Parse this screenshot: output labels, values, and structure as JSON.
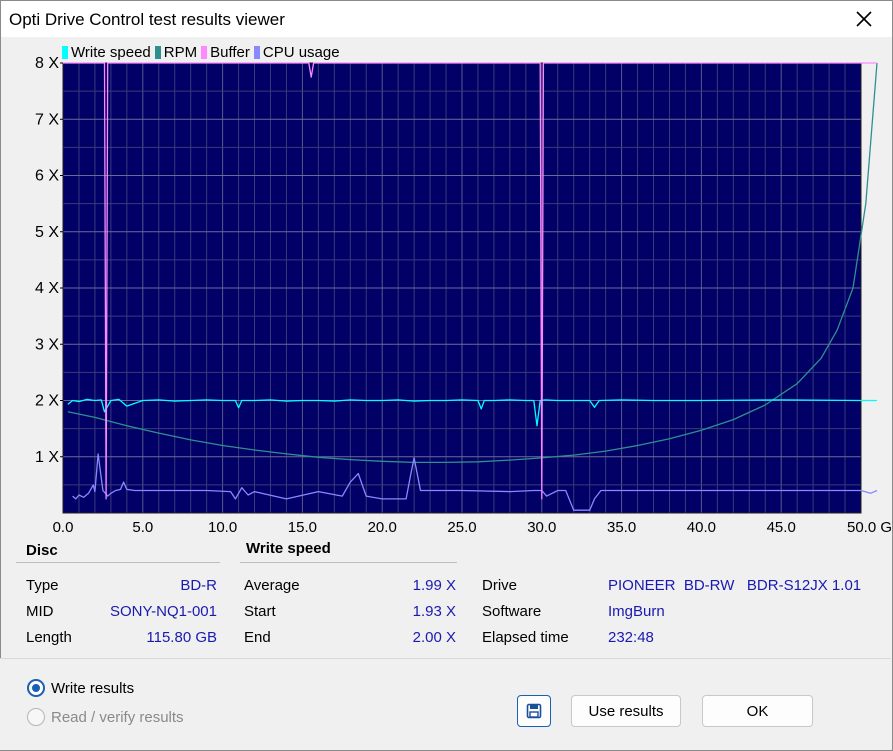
{
  "window": {
    "title": "Opti Drive Control test results viewer"
  },
  "legend": [
    {
      "label": "Write speed",
      "color": "#00ffff"
    },
    {
      "label": "RPM",
      "color": "#2f8f8f"
    },
    {
      "label": "Buffer",
      "color": "#ff88ff"
    },
    {
      "label": "CPU usage",
      "color": "#8888ff"
    }
  ],
  "chart_data": {
    "type": "line",
    "xlabel": "",
    "ylabel": "",
    "xlim": [
      0,
      50
    ],
    "ylim": [
      0,
      8
    ],
    "x_ticks": [
      "0.0",
      "5.0",
      "10.0",
      "15.0",
      "20.0",
      "25.0",
      "30.0",
      "35.0",
      "40.0",
      "45.0",
      "50.0 GB"
    ],
    "y_ticks": [
      "1 X",
      "2 X",
      "3 X",
      "4 X",
      "5 X",
      "6 X",
      "7 X",
      "8 X"
    ],
    "grid": true,
    "legend_position": "top-left",
    "series": [
      {
        "name": "Write speed",
        "color": "#00ffff",
        "x": [
          0.3,
          0.6,
          1.0,
          1.5,
          2.0,
          2.4,
          2.6,
          3.0,
          3.5,
          4.0,
          5.0,
          6.0,
          7.0,
          8.0,
          9.0,
          10.0,
          10.8,
          11.0,
          11.2,
          12.0,
          13.0,
          14.0,
          15.0,
          16.0,
          17.0,
          18.0,
          19.0,
          20.0,
          21.0,
          22.0,
          23.0,
          24.0,
          25.0,
          26.0,
          26.2,
          26.4,
          27.0,
          28.0,
          29.0,
          29.5,
          29.7,
          29.9,
          30.2,
          31.0,
          32.0,
          33.0,
          33.3,
          33.6,
          35.0,
          37.0,
          40.0,
          45.0,
          50.0,
          51.0
        ],
        "y": [
          1.93,
          2.0,
          1.98,
          2.02,
          2.0,
          2.01,
          1.8,
          2.0,
          2.02,
          1.9,
          2.0,
          2.01,
          1.99,
          2.0,
          2.01,
          2.0,
          2.0,
          1.87,
          2.0,
          2.0,
          2.01,
          1.99,
          2.0,
          2.0,
          1.99,
          2.01,
          2.0,
          2.0,
          2.01,
          1.99,
          2.0,
          2.0,
          2.01,
          2.0,
          1.85,
          2.0,
          2.0,
          2.01,
          2.0,
          2.0,
          1.55,
          2.0,
          2.01,
          2.0,
          2.0,
          2.0,
          1.88,
          2.0,
          2.01,
          2.0,
          2.0,
          2.01,
          2.0,
          2.0
        ]
      },
      {
        "name": "RPM",
        "color": "#2f8f8f",
        "x": [
          0.3,
          2.0,
          4.0,
          6.0,
          8.0,
          10.0,
          12.0,
          14.0,
          16.0,
          18.0,
          20.0,
          22.0,
          24.0,
          26.0,
          28.0,
          30.0,
          32.0,
          34.0,
          36.0,
          38.0,
          40.0,
          42.0,
          44.0,
          46.0,
          47.5,
          48.5,
          49.5,
          50.3,
          51.0
        ],
        "y": [
          1.8,
          1.7,
          1.55,
          1.42,
          1.3,
          1.2,
          1.12,
          1.05,
          0.99,
          0.95,
          0.92,
          0.9,
          0.9,
          0.91,
          0.94,
          0.98,
          1.03,
          1.1,
          1.2,
          1.32,
          1.47,
          1.66,
          1.92,
          2.3,
          2.75,
          3.25,
          4.0,
          5.5,
          8.0
        ]
      },
      {
        "name": "Buffer",
        "color": "#ff88ff",
        "x": [
          0.0,
          2.6,
          2.7,
          2.8,
          15.4,
          15.55,
          15.7,
          29.9,
          30.0,
          30.1,
          51.0
        ],
        "y": [
          8.0,
          8.0,
          0.25,
          8.0,
          8.0,
          7.75,
          8.0,
          8.0,
          0.25,
          8.0,
          8.0
        ]
      },
      {
        "name": "CPU usage",
        "color": "#8888ff",
        "x": [
          0.6,
          0.8,
          1.0,
          1.3,
          1.6,
          1.9,
          2.0,
          2.2,
          2.5,
          2.8,
          3.0,
          3.3,
          3.6,
          3.8,
          4.0,
          4.5,
          5.0,
          7.0,
          9.0,
          10.5,
          10.8,
          11.2,
          11.6,
          12.0,
          14.0,
          16.0,
          17.5,
          18.0,
          18.5,
          19.0,
          20.0,
          21.5,
          21.8,
          22.0,
          22.4,
          25.0,
          28.0,
          29.5,
          30.0,
          30.3,
          31.0,
          31.5,
          32.0,
          33.0,
          33.3,
          33.7,
          34.0,
          40.0,
          45.0,
          50.0,
          50.6,
          51.0
        ],
        "y": [
          0.3,
          0.25,
          0.32,
          0.28,
          0.35,
          0.5,
          0.38,
          1.05,
          0.4,
          0.3,
          0.35,
          0.4,
          0.42,
          0.55,
          0.42,
          0.4,
          0.4,
          0.4,
          0.4,
          0.38,
          0.25,
          0.45,
          0.32,
          0.38,
          0.25,
          0.38,
          0.3,
          0.55,
          0.7,
          0.3,
          0.25,
          0.25,
          0.7,
          0.98,
          0.4,
          0.4,
          0.38,
          0.4,
          0.4,
          0.3,
          0.4,
          0.4,
          0.05,
          0.05,
          0.25,
          0.4,
          0.4,
          0.4,
          0.4,
          0.4,
          0.35,
          0.4
        ]
      }
    ]
  },
  "disc": {
    "title": "Disc",
    "rows": [
      {
        "label": "Type",
        "value": "BD-R"
      },
      {
        "label": "MID",
        "value": "SONY-NQ1-001"
      },
      {
        "label": "Length",
        "value": "115.80 GB"
      }
    ]
  },
  "write_speed": {
    "title": "Write speed",
    "rows": [
      {
        "label": "Average",
        "value": "1.99 X"
      },
      {
        "label": "Start",
        "value": "1.93 X"
      },
      {
        "label": "End",
        "value": "2.00 X"
      }
    ]
  },
  "info": {
    "rows": [
      {
        "label": "Drive",
        "value": "PIONEER  BD-RW   BDR-S12JX 1.01"
      },
      {
        "label": "Software",
        "value": "ImgBurn"
      },
      {
        "label": "Elapsed time",
        "value": "232:48"
      }
    ]
  },
  "options": {
    "write_results": "Write results",
    "read_verify_results": "Read / verify results",
    "selected": "write_results"
  },
  "buttons": {
    "use_results": "Use results",
    "ok": "OK"
  },
  "icons": {
    "close": "close-icon",
    "save": "save-icon"
  }
}
